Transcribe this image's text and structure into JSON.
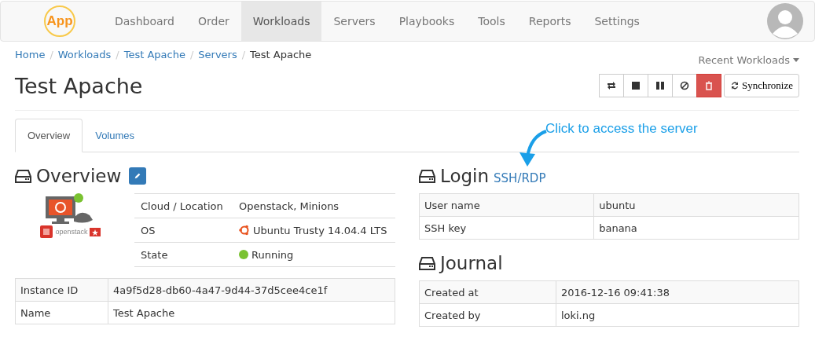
{
  "navbar": {
    "brand": "App",
    "items": [
      {
        "label": "Dashboard",
        "selected": false
      },
      {
        "label": "Order",
        "selected": false
      },
      {
        "label": "Workloads",
        "selected": true
      },
      {
        "label": "Servers",
        "selected": false
      },
      {
        "label": "Playbooks",
        "selected": false
      },
      {
        "label": "Tools",
        "selected": false
      },
      {
        "label": "Reports",
        "selected": false
      },
      {
        "label": "Settings",
        "selected": false
      }
    ]
  },
  "breadcrumb_separator": "/",
  "breadcrumb": [
    {
      "label": "Home",
      "link": true
    },
    {
      "label": "Workloads",
      "link": true
    },
    {
      "label": "Test Apache",
      "link": true
    },
    {
      "label": "Servers",
      "link": true
    },
    {
      "label": "Test Apache",
      "link": false
    }
  ],
  "recent_menu": "Recent Workloads",
  "title": "Test Apache",
  "actions": [
    {
      "kind": "restart",
      "danger": false
    },
    {
      "kind": "stop",
      "danger": false
    },
    {
      "kind": "pause",
      "danger": false
    },
    {
      "kind": "ban",
      "danger": false
    },
    {
      "kind": "delete",
      "danger": true
    }
  ],
  "sync_button": "Synchronize",
  "tabs": [
    {
      "label": "Overview",
      "selected": true
    },
    {
      "label": "Volumes",
      "selected": false
    }
  ],
  "annotation": "Click to access the server",
  "overview": {
    "heading": "Overview",
    "logo_text": "openstack",
    "details": [
      {
        "kind": "text",
        "label": "Cloud / Location",
        "value": "Openstack, Minions"
      },
      {
        "kind": "os",
        "label": "OS",
        "value": "Ubuntu Trusty 14.04.4 LTS"
      },
      {
        "kind": "status",
        "label": "State",
        "value": "Running",
        "color": "#7ac231"
      }
    ],
    "table": [
      {
        "label": "Instance ID",
        "value": "4a9f5d28-db60-4a47-9d44-37d5cee4ce1f"
      },
      {
        "label": "Name",
        "value": "Test Apache"
      }
    ]
  },
  "login": {
    "heading": "Login",
    "link": "SSH/RDP",
    "rows": [
      {
        "label": "User name",
        "value": "ubuntu"
      },
      {
        "label": "SSH key",
        "value": "banana"
      }
    ]
  },
  "journal": {
    "heading": "Journal",
    "rows": [
      {
        "label": "Created at",
        "value": "2016-12-16 09:41:38"
      },
      {
        "label": "Created by",
        "value": "loki.ng"
      }
    ]
  }
}
